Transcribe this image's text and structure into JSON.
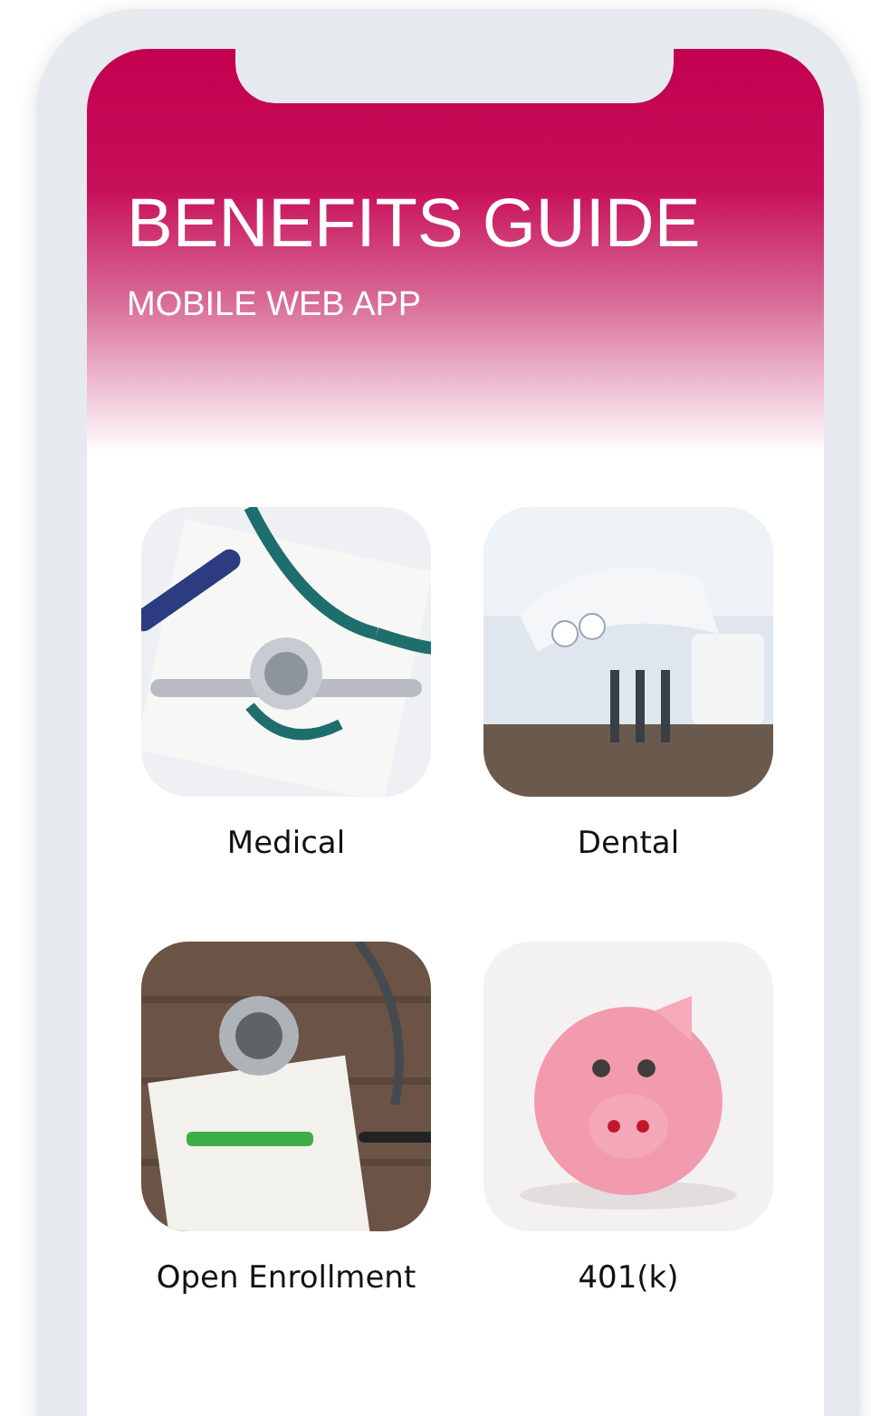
{
  "header": {
    "title": "BENEFITS GUIDE",
    "subtitle": "MOBILE WEB APP"
  },
  "tiles": [
    {
      "label": "Medical"
    },
    {
      "label": "Dental"
    },
    {
      "label": "Open Enrollment"
    },
    {
      "label": "401(k)"
    }
  ]
}
